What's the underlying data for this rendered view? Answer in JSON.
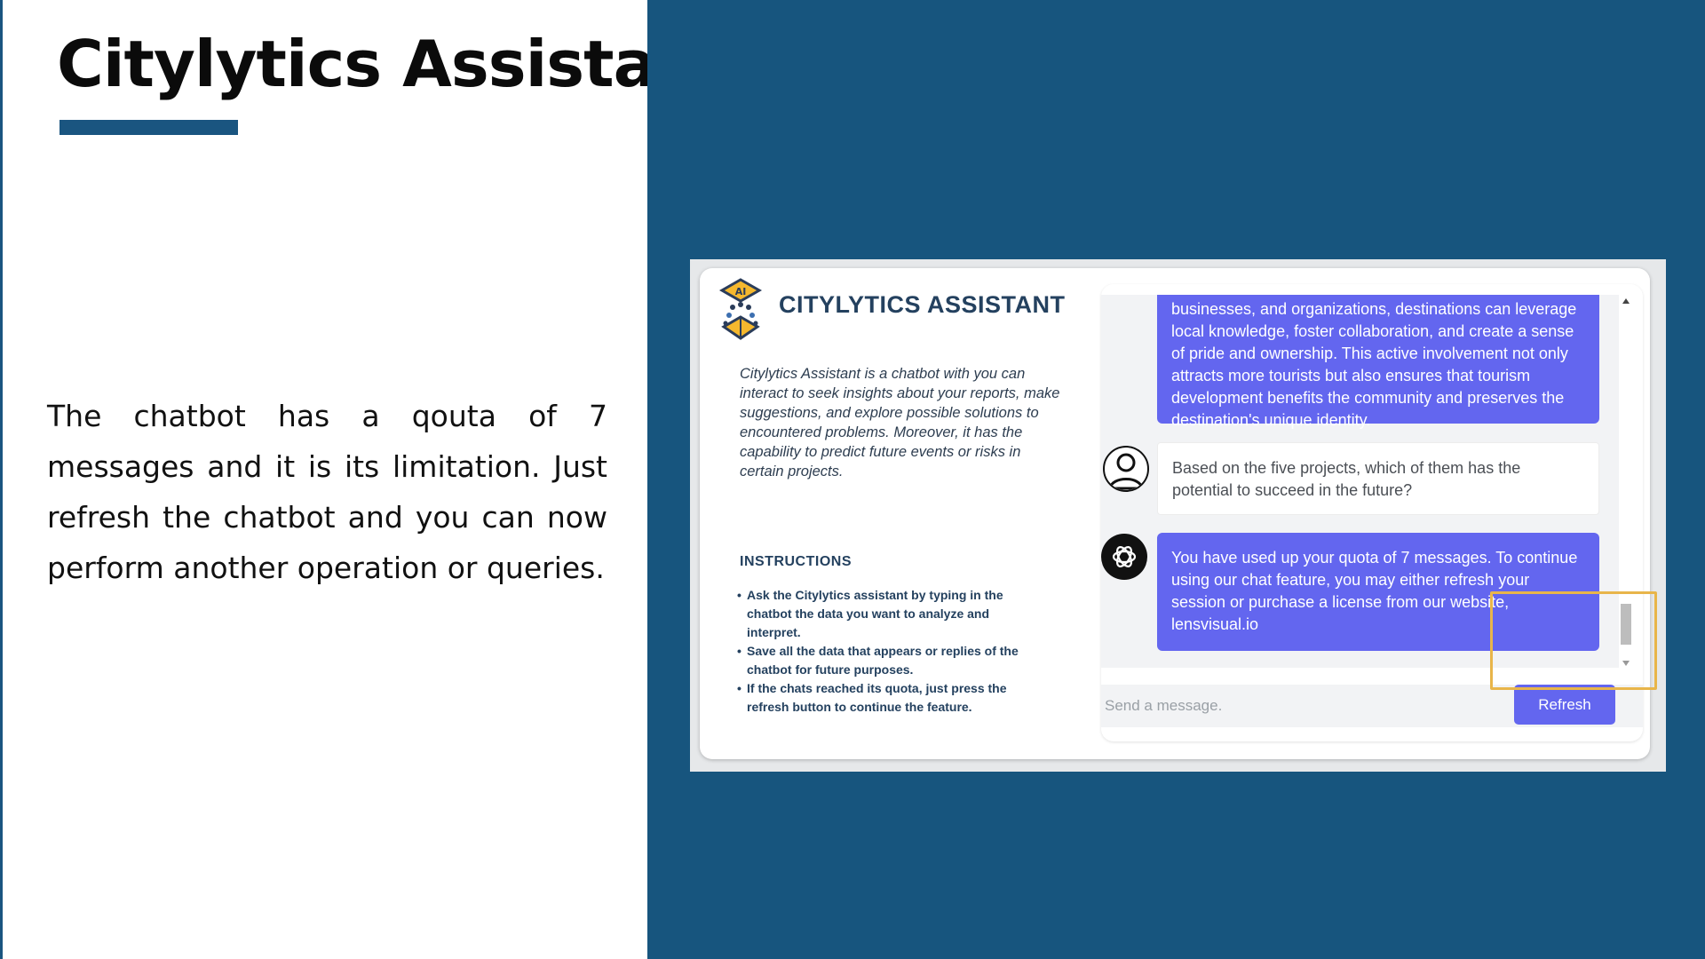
{
  "slide": {
    "title": "Citylytics Assistant",
    "body": "The chatbot has a qouta of 7 messages and it is its limitation. Just refresh the chatbot and you can now perform another operation or queries."
  },
  "app": {
    "title": "CITYLYTICS ASSISTANT",
    "logo_text": "AI",
    "description": "Citylytics Assistant is a chatbot with you can interact to seek insights about your  reports, make suggestions, and explore possible solutions to encountered problems. Moreover, it has the capability to predict future events or risks in certain projects.",
    "instructions_heading": "INSTRUCTIONS",
    "instructions": [
      "Ask the Citylytics assistant by typing in the chatbot the data you want to analyze and interpret.",
      "Save all the data that appears or replies of the chatbot for future purposes.",
      "If the chats reached its quota, just press the refresh button to continue the feature."
    ]
  },
  "chat": {
    "messages": [
      {
        "role": "bot",
        "text": "businesses, and organizations, destinations can leverage local knowledge, foster collaboration, and create a sense of pride and ownership. This active involvement not only attracts more tourists but also ensures that tourism development benefits the community and preserves the destination's unique identity."
      },
      {
        "role": "user",
        "text": "Based on the five projects, which of them has the potential to succeed in the future?"
      },
      {
        "role": "bot",
        "text": "You have used up your quota of 7 messages. To continue using our chat feature, you may either refresh your session or purchase a license from our website, lensvisual.io"
      }
    ],
    "input_placeholder": "Send a message.",
    "refresh_label": "Refresh"
  },
  "colors": {
    "brand_blue": "#17557e",
    "accent_purple": "#6366ef",
    "highlight": "#e8b54a"
  },
  "icons": {
    "logo": "ai-cube-icon",
    "user_avatar": "user-avatar-icon",
    "bot_avatar": "openai-logo-icon"
  }
}
